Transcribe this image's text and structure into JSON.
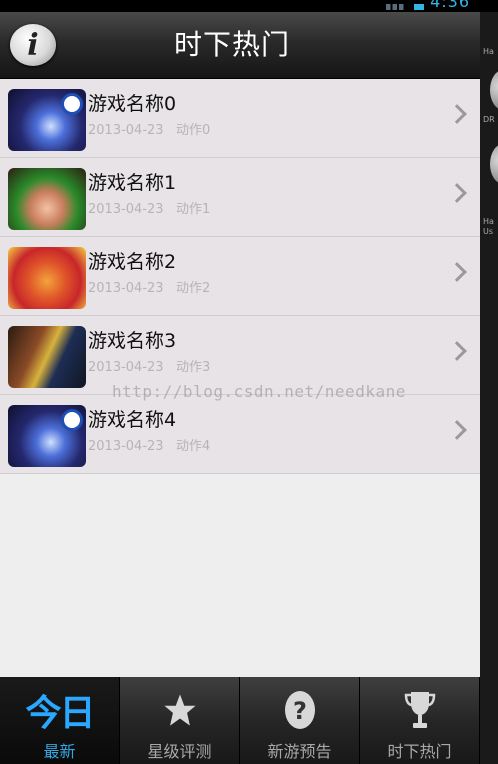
{
  "status_bar": {
    "time": "4:36"
  },
  "side_panel": {
    "labels": [
      "Ha",
      "DR",
      "Ha",
      "Us"
    ]
  },
  "header": {
    "title": "时下热门",
    "info_label": "i"
  },
  "games": [
    {
      "name": "游戏名称0",
      "date": "2013-04-23",
      "category": "动作0",
      "icon": "game-icon-dragon"
    },
    {
      "name": "游戏名称1",
      "date": "2013-04-23",
      "category": "动作1",
      "icon": "game-icon-heroine"
    },
    {
      "name": "游戏名称2",
      "date": "2013-04-23",
      "category": "动作2",
      "icon": "game-icon-barbarian"
    },
    {
      "name": "游戏名称3",
      "date": "2013-04-23",
      "category": "动作3",
      "icon": "game-icon-warriors"
    },
    {
      "name": "游戏名称4",
      "date": "2013-04-23",
      "category": "动作4",
      "icon": "game-icon-dragon"
    }
  ],
  "watermark": "http://blog.csdn.net/needkane",
  "tabs": [
    {
      "label": "最新",
      "glyph": "今日",
      "icon": "today-icon",
      "active": true
    },
    {
      "label": "星级评测",
      "icon": "star-icon",
      "active": false
    },
    {
      "label": "新游预告",
      "icon": "question-icon",
      "active": false
    },
    {
      "label": "时下热门",
      "icon": "trophy-icon",
      "active": false
    }
  ],
  "colors": {
    "accent": "#33a8e0",
    "list_bg": "#e7e3e6",
    "header_bg": "#2a2a2a"
  }
}
